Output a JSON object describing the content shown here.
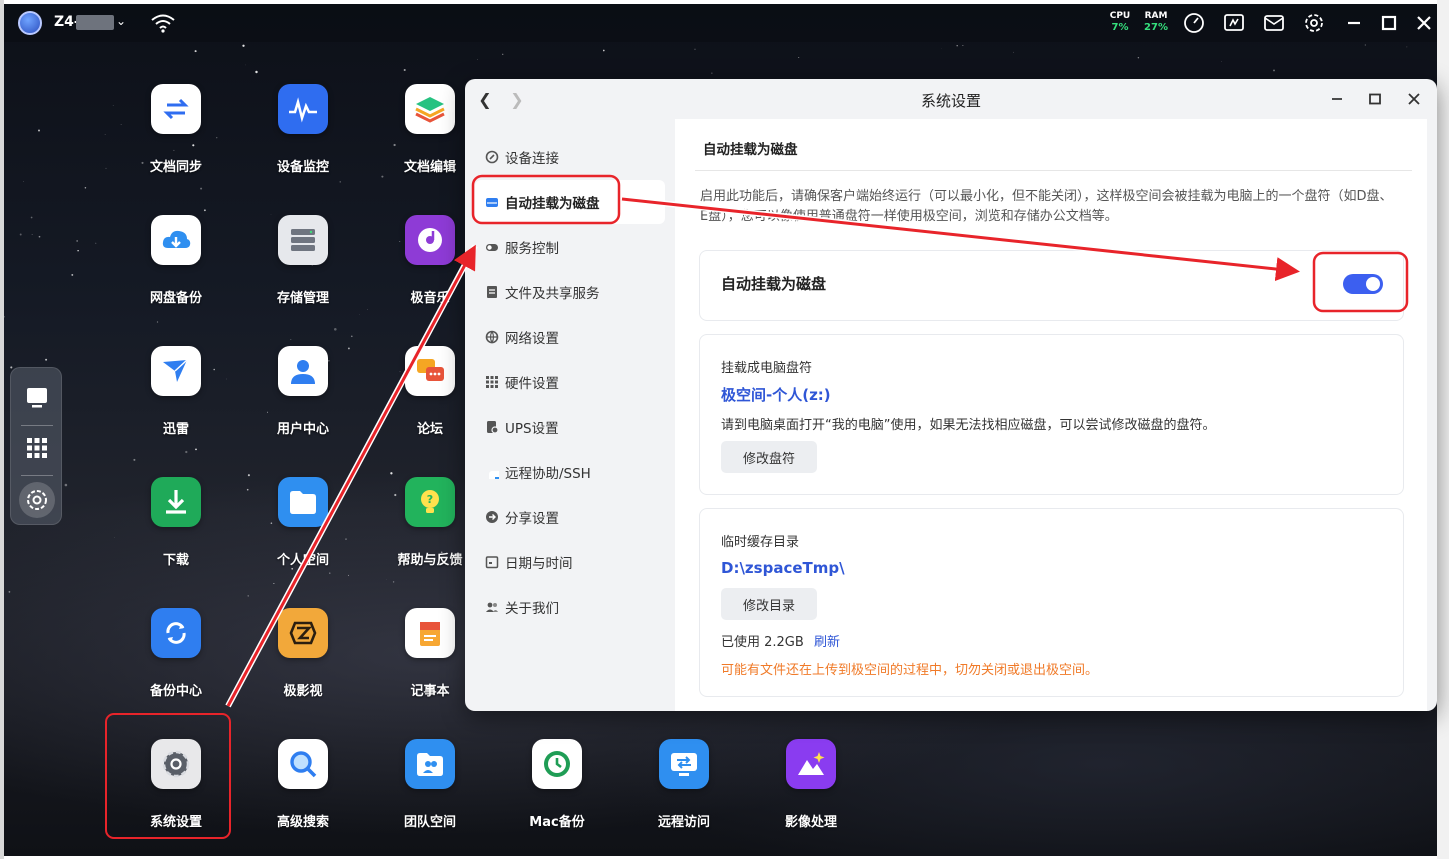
{
  "topbar": {
    "device_name": "Z4-",
    "cpu_label": "CPU",
    "cpu_value": "7%",
    "ram_label": "RAM",
    "ram_value": "27%",
    "icons": [
      "speed-icon",
      "monitor-icon",
      "mail-icon",
      "gear-icon",
      "minimize-icon",
      "maximize-icon",
      "close-icon"
    ]
  },
  "dock": {
    "items": [
      "desktop-icon",
      "apps-grid-icon",
      "settings-icon"
    ]
  },
  "apps": [
    {
      "label": "文档同步",
      "icon": "sync-icon",
      "color": "#ffffff"
    },
    {
      "label": "设备监控",
      "icon": "monitor-wave-icon",
      "color": "#2f6df0"
    },
    {
      "label": "文档编辑",
      "icon": "layers-icon",
      "color": "#ffffff"
    },
    {
      "label": "网盘备份",
      "icon": "cloud-download-icon",
      "color": "#ffffff"
    },
    {
      "label": "存储管理",
      "icon": "storage-icon",
      "color": "#e6e8ec"
    },
    {
      "label": "极音乐",
      "icon": "music-icon",
      "color": "#8e3bd6"
    },
    {
      "label": "迅雷",
      "icon": "bird-icon",
      "color": "#ffffff"
    },
    {
      "label": "用户中心",
      "icon": "user-icon",
      "color": "#ffffff"
    },
    {
      "label": "论坛",
      "icon": "chat-icon",
      "color": "#ffffff"
    },
    {
      "label": "下载",
      "icon": "download-icon",
      "color": "#1faa59"
    },
    {
      "label": "个人空间",
      "icon": "folder-icon",
      "color": "#2f8ff0"
    },
    {
      "label": "帮助与反馈",
      "icon": "help-bulb-icon",
      "color": "#22b35c"
    },
    {
      "label": "备份中心",
      "icon": "backup-icon",
      "color": "#2f7ef0"
    },
    {
      "label": "极影视",
      "icon": "film-icon",
      "color": "#f2a83a"
    },
    {
      "label": "记事本",
      "icon": "notepad-icon",
      "color": "#ffffff"
    },
    {
      "label": "系统设置",
      "icon": "gear-icon",
      "color": "#e8e8ea"
    },
    {
      "label": "高级搜索",
      "icon": "search-icon",
      "color": "#ffffff"
    },
    {
      "label": "团队空间",
      "icon": "team-folder-icon",
      "color": "#2f8ff0"
    },
    {
      "label": "Mac备份",
      "icon": "clock-icon",
      "color": "#ffffff"
    },
    {
      "label": "远程访问",
      "icon": "remote-icon",
      "color": "#2f8ff0"
    },
    {
      "label": "影像处理",
      "icon": "image-process-icon",
      "color": "#8a3cf0"
    }
  ],
  "window": {
    "title": "系统设置",
    "nav": [
      {
        "label": "设备连接",
        "icon": "link-icon"
      },
      {
        "label": "自动挂载为磁盘",
        "icon": "disk-icon",
        "active": true
      },
      {
        "label": "服务控制",
        "icon": "toggle-icon"
      },
      {
        "label": "文件及共享服务",
        "icon": "file-icon"
      },
      {
        "label": "网络设置",
        "icon": "globe-icon"
      },
      {
        "label": "硬件设置",
        "icon": "grid-icon"
      },
      {
        "label": "UPS设置",
        "icon": "ups-icon"
      },
      {
        "label": "远程协助/SSH",
        "icon": "remote-icon"
      },
      {
        "label": "分享设置",
        "icon": "share-icon"
      },
      {
        "label": "日期与时间",
        "icon": "calendar-icon"
      },
      {
        "label": "关于我们",
        "icon": "people-icon"
      }
    ],
    "content": {
      "heading": "自动挂载为磁盘",
      "description": "启用此功能后，请确保客户端始终运行（可以最小化，但不能关闭），这样极空间会被挂载为电脑上的一个盘符（如D盘、E盘），您可以像使用普通盘符一样使用极空间，浏览和存储办公文档等。",
      "toggle_label": "自动挂载为磁盘",
      "toggle_on": true,
      "drive_label": "挂载成电脑盘符",
      "drive_value": "极空间-个人(z:)",
      "drive_hint": "请到电脑桌面打开“我的电脑”使用，如果无法找相应磁盘，可以尝试修改磁盘的盘符。",
      "drive_button": "修改盘符",
      "cache_label": "临时缓存目录",
      "cache_value": "D:\\zspaceTmp\\",
      "cache_button": "修改目录",
      "used_text": "已使用 2.2GB",
      "refresh": "刷新",
      "warning": "可能有文件还在上传到极空间的过程中，切勿关闭或退出极空间。"
    }
  },
  "colors": {
    "accent": "#3c5ff0",
    "highlight": "#e8242a",
    "warning": "#f07a28"
  }
}
